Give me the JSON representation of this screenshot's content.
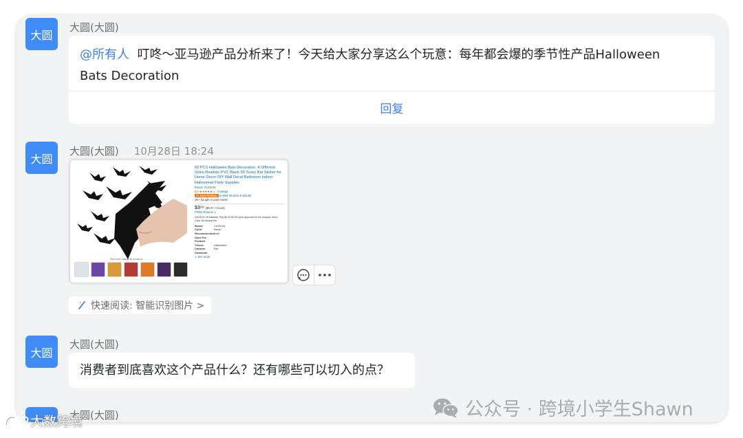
{
  "messages": [
    {
      "avatar_text": "大圆",
      "sender": "大圆(大圆)",
      "mention": "@所有人",
      "text_line1": "叮咚～亚马逊产品分析来了！今天给大家分享这么个玩意：每年都会爆的季节性产品Halloween",
      "text_line2": "Bats Decoration",
      "reply_label": "回复"
    },
    {
      "avatar_text": "大圆",
      "sender": "大圆(大圆)",
      "time": "10月28日 18:24",
      "product": {
        "title": "60 PCS Halloween Bats Decoration, 4 Different Sizes Realistic PVC Black 3D Scary Bat Sticker for Home Decor DIY Wall Decal Bathroom Indoor Hallowmas Party Supplies",
        "brand_line": "Brand: YKZKUN",
        "rating": "5.0 ★★★★★ ∨",
        "ratings_count": "3 ratings",
        "badge": "#1 New Release",
        "badge_category": "in Wall Stickers & Murals",
        "bought": "1K+ bought in past month",
        "price": "$3⁹⁹",
        "price_unit": "($0.07 / Count)",
        "returns": "FREE Returns ∨",
        "promo": "Get $100 off instantly: Pay $0.00 $3.99 upon approval for the Amazon Store Card. No annual fee.",
        "specs": [
          {
            "k": "Brand",
            "v": "YKZKUN"
          },
          {
            "k": "Color",
            "v": "Black"
          },
          {
            "k": "Recommended Uses For Product",
            "v": "Wall"
          },
          {
            "k": "Theme",
            "v": "Halloween"
          },
          {
            "k": "Cartoon Character",
            "v": "Bat"
          }
        ],
        "see_more": "∨ See more",
        "image_caption": "Roll over image to zoom in"
      },
      "quick_read": "快速阅读: 智能识别图片 >"
    },
    {
      "avatar_text": "大圆",
      "sender": "大圆(大圆)",
      "text": "消费者到底喜欢这个产品什么？还有哪些可以切入的点？"
    },
    {
      "avatar_text": "大圆",
      "sender": "大圆(大圆)"
    }
  ],
  "watermark": "公众号 · 跨境小学生Shawn",
  "corner_mark": "大数跨境",
  "colors": {
    "avatar": "#3f8cf6",
    "accent": "#3f7fe8",
    "panel_bg": "#f2f3f5"
  }
}
